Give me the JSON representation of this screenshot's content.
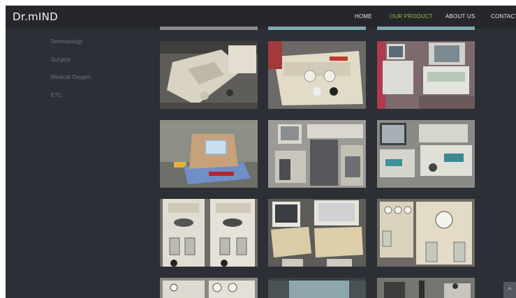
{
  "brand": {
    "logo": "Dr.mIND"
  },
  "nav": {
    "items": [
      {
        "label": "HOME",
        "active": false
      },
      {
        "label": "OUR PRODUCT",
        "active": true
      },
      {
        "label": "ABOUT US",
        "active": false
      },
      {
        "label": "CONTACT",
        "active": false
      }
    ]
  },
  "sidebar": {
    "items": [
      {
        "label": "Dermatology"
      },
      {
        "label": "Surgery"
      },
      {
        "label": "Medical Oxygen"
      },
      {
        "label": "ETC"
      }
    ]
  },
  "products": [
    {
      "icon": "patient-monitor-photo"
    },
    {
      "icon": "stimulator-device-photo"
    },
    {
      "icon": "ultrasound-cart-photo"
    },
    {
      "icon": "aesthetic-laser-photo"
    },
    {
      "icon": "workstation-cart-photo"
    },
    {
      "icon": "monitor-cart-photo"
    },
    {
      "icon": "suction-unit-photo"
    },
    {
      "icon": "ultrasound-console-photo"
    },
    {
      "icon": "aspirator-bottles-photo"
    },
    {
      "icon": "gauge-unit-photo"
    },
    {
      "icon": "blue-device-photo"
    },
    {
      "icon": "machine-parts-photo"
    }
  ],
  "colors": {
    "accent": "#9cc33a",
    "header_bg": "#25272d",
    "page_bg": "#2c2f36"
  },
  "scroll_top": {
    "icon": "chevron-up-icon",
    "glyph": "^"
  }
}
